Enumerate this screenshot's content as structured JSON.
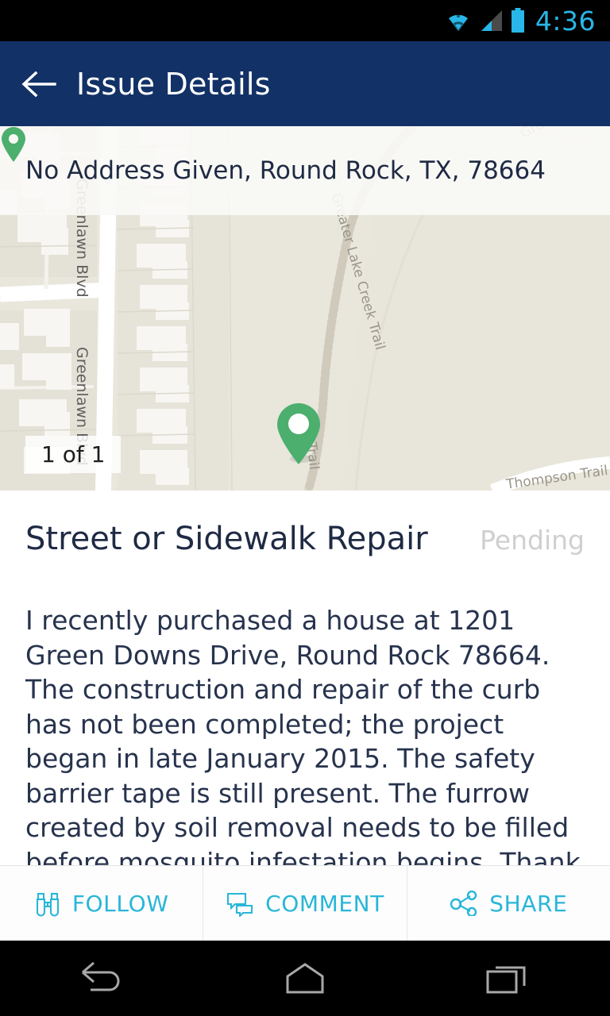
{
  "statusbar": {
    "time": "4:36",
    "wifi_icon": "wifi-icon",
    "signal_icon": "cellular-signal-icon",
    "battery_icon": "battery-icon",
    "accent_color": "#29b6e8"
  },
  "appbar": {
    "title": "Issue Details",
    "back_icon": "back-arrow-icon",
    "background_color": "#123166",
    "title_color": "#ffffff"
  },
  "map": {
    "address": "No Address Given, Round Rock, TX, 78664",
    "address_pin_icon": "location-pin-icon",
    "count_badge": "1 of 1",
    "marker_icon": "map-marker-icon",
    "marker_color": "#4CAF6D",
    "background_color": "#e9e6dc",
    "labels": [
      {
        "text": "Greenlawn Blvd",
        "kind": "street"
      },
      {
        "text": "Greenlawn Blvd",
        "kind": "street"
      },
      {
        "text": "Greater Lake Creek Trail",
        "kind": "trail"
      },
      {
        "text": "Gre",
        "kind": "trail"
      },
      {
        "text": "k Trail",
        "kind": "trail"
      },
      {
        "text": "Thompson Trail",
        "kind": "trail"
      }
    ]
  },
  "issue": {
    "title": "Street or Sidewalk Repair",
    "status": "Pending",
    "status_color": "#cfcfcf",
    "description": "I recently purchased a house at 1201 Green Downs Drive, Round Rock 78664. The construction and repair of the curb has not been completed; the project began in late January 2015. The safety barrier tape is still present. The furrow created by soil removal needs to be filled before mosquito infestation begins. Thank you. Maxine Streeter"
  },
  "actions": {
    "accent_color": "#29b6d8",
    "items": [
      {
        "label": "FOLLOW",
        "icon": "binoculars-icon"
      },
      {
        "label": "COMMENT",
        "icon": "comment-bubbles-icon"
      },
      {
        "label": "SHARE",
        "icon": "share-nodes-icon"
      }
    ]
  },
  "navbar": {
    "back_icon": "android-back-icon",
    "home_icon": "android-home-icon",
    "recents_icon": "android-recents-icon"
  }
}
